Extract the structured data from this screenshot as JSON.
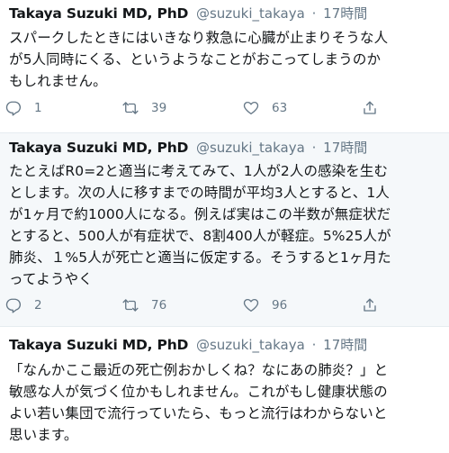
{
  "tweets": [
    {
      "author_name": "Takaya Suzuki MD, PhD",
      "handle": "@suzuki_takaya",
      "separator": "·",
      "timestamp": "17時間",
      "text_lines": [
        "スパークしたときにはいきなり救急に心臓が止まりそうな人",
        "が5人同時にくる、というようなことがおこってしまうのか",
        "もしれません。"
      ],
      "replies": "1",
      "retweets": "39",
      "likes": "63",
      "highlighted": false
    },
    {
      "author_name": "Takaya Suzuki MD, PhD",
      "handle": "@suzuki_takaya",
      "separator": "·",
      "timestamp": "17時間",
      "text_lines": [
        "たとえばR0=2と適当に考えてみて、1人が2人の感染を生む",
        "とします。次の人に移すまでの時間が平均3人とすると、1人",
        "が1ヶ月で約1000人になる。例えば実はこの半数が無症状だ",
        "とすると、500人が有症状で、8割400人が軽症。5%25人が",
        "肺炎、１%5人が死亡と適当に仮定する。そうすると1ヶ月た",
        "ってようやく"
      ],
      "replies": "2",
      "retweets": "76",
      "likes": "96",
      "highlighted": true
    },
    {
      "author_name": "Takaya Suzuki MD, PhD",
      "handle": "@suzuki_takaya",
      "separator": "·",
      "timestamp": "17時間",
      "text_lines": [
        "「なんかここ最近の死亡例おかしくね？なにあの肺炎？」と",
        "敏感な人が気づく位かもしれません。これがもし健康状態の",
        "よい若い集団で流行っていたら、もっと流行はわからないと",
        "思います。"
      ],
      "highlighted": false
    }
  ],
  "icons": {
    "reply": "reply-icon",
    "retweet": "retweet-icon",
    "like": "heart-icon",
    "share": "share-icon"
  },
  "colors": {
    "text": "#14171a",
    "secondary": "#657786",
    "highlight_bg": "#f5f8fa",
    "divider": "#e6ecf0"
  }
}
